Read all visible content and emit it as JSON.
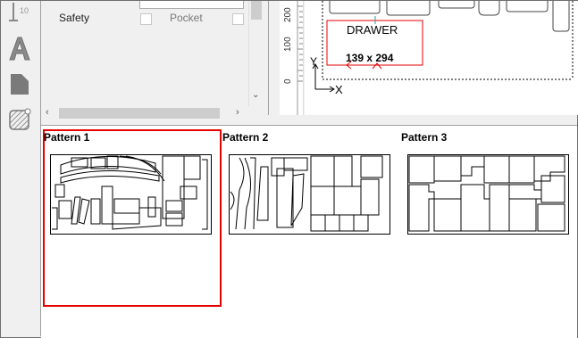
{
  "properties": {
    "rows": [
      {
        "label": "Safety",
        "value_label": "Pocket"
      }
    ]
  },
  "ruler": {
    "labels": [
      "200",
      "100",
      "0"
    ]
  },
  "toolbar": {
    "top_tool_number": "10"
  },
  "drawing": {
    "part_name": "DRAWER",
    "part_size": "139 x 294",
    "axis_x": "X",
    "axis_y": "Y"
  },
  "patterns": [
    {
      "label": "Pattern 1",
      "selected": true
    },
    {
      "label": "Pattern 2",
      "selected": false
    },
    {
      "label": "Pattern 3",
      "selected": false
    }
  ],
  "colors": {
    "selection": "#e60000",
    "panel_bg": "#f0f0f0"
  }
}
